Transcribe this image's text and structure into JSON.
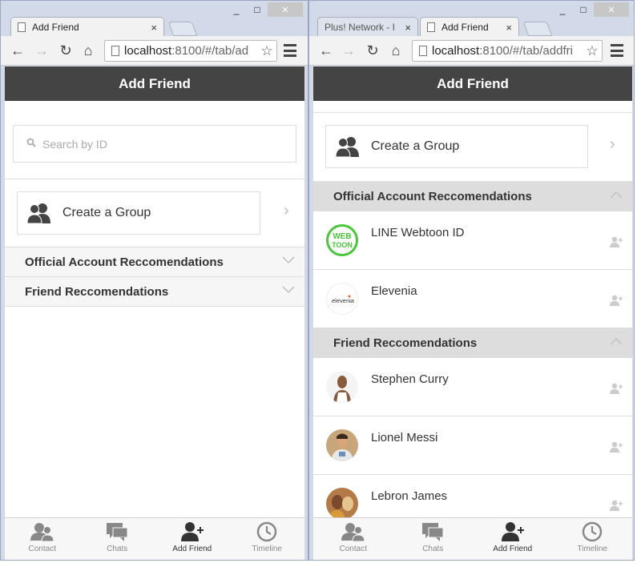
{
  "left": {
    "tabs": [
      {
        "title": "Add Friend",
        "close": "×"
      }
    ],
    "url": {
      "host": "localhost",
      "rest": ":8100/#/tab/ad"
    },
    "header_title": "Add Friend",
    "search": {
      "placeholder": "Search by ID"
    },
    "create_group_label": "Create a Group",
    "sections": [
      {
        "title": "Official Account Reccomendations",
        "state": "collapsed"
      },
      {
        "title": "Friend Reccomendations",
        "state": "collapsed"
      }
    ]
  },
  "right": {
    "tabs": [
      {
        "title": "Plus! Network - I",
        "close": "×"
      },
      {
        "title": "Add Friend",
        "close": "×"
      }
    ],
    "url": {
      "host": "localhost",
      "rest": ":8100/#/tab/addfri"
    },
    "header_title": "Add Friend",
    "create_group_label": "Create a Group",
    "official": {
      "title": "Official Account Reccomendations",
      "items": [
        {
          "name": "LINE Webtoon ID",
          "avatar_text": "WEB TOON"
        },
        {
          "name": "Elevenia",
          "avatar_text": "elevenia"
        }
      ]
    },
    "friends": {
      "title": "Friend Reccomendations",
      "items": [
        {
          "name": "Stephen Curry"
        },
        {
          "name": "Lionel Messi"
        },
        {
          "name": "Lebron James"
        }
      ]
    }
  },
  "tabbar": [
    {
      "label": "Contact",
      "icon": "contact-icon"
    },
    {
      "label": "Chats",
      "icon": "chats-icon"
    },
    {
      "label": "Add Friend",
      "icon": "add-friend-icon",
      "active": true
    },
    {
      "label": "Timeline",
      "icon": "timeline-icon"
    }
  ],
  "window_controls": {
    "minimize": "_",
    "maximize": "□",
    "close": "×"
  },
  "colors": {
    "header": "#444444",
    "webtoon_green": "#4ac63a",
    "elevenia_orange": "#e8692c"
  }
}
